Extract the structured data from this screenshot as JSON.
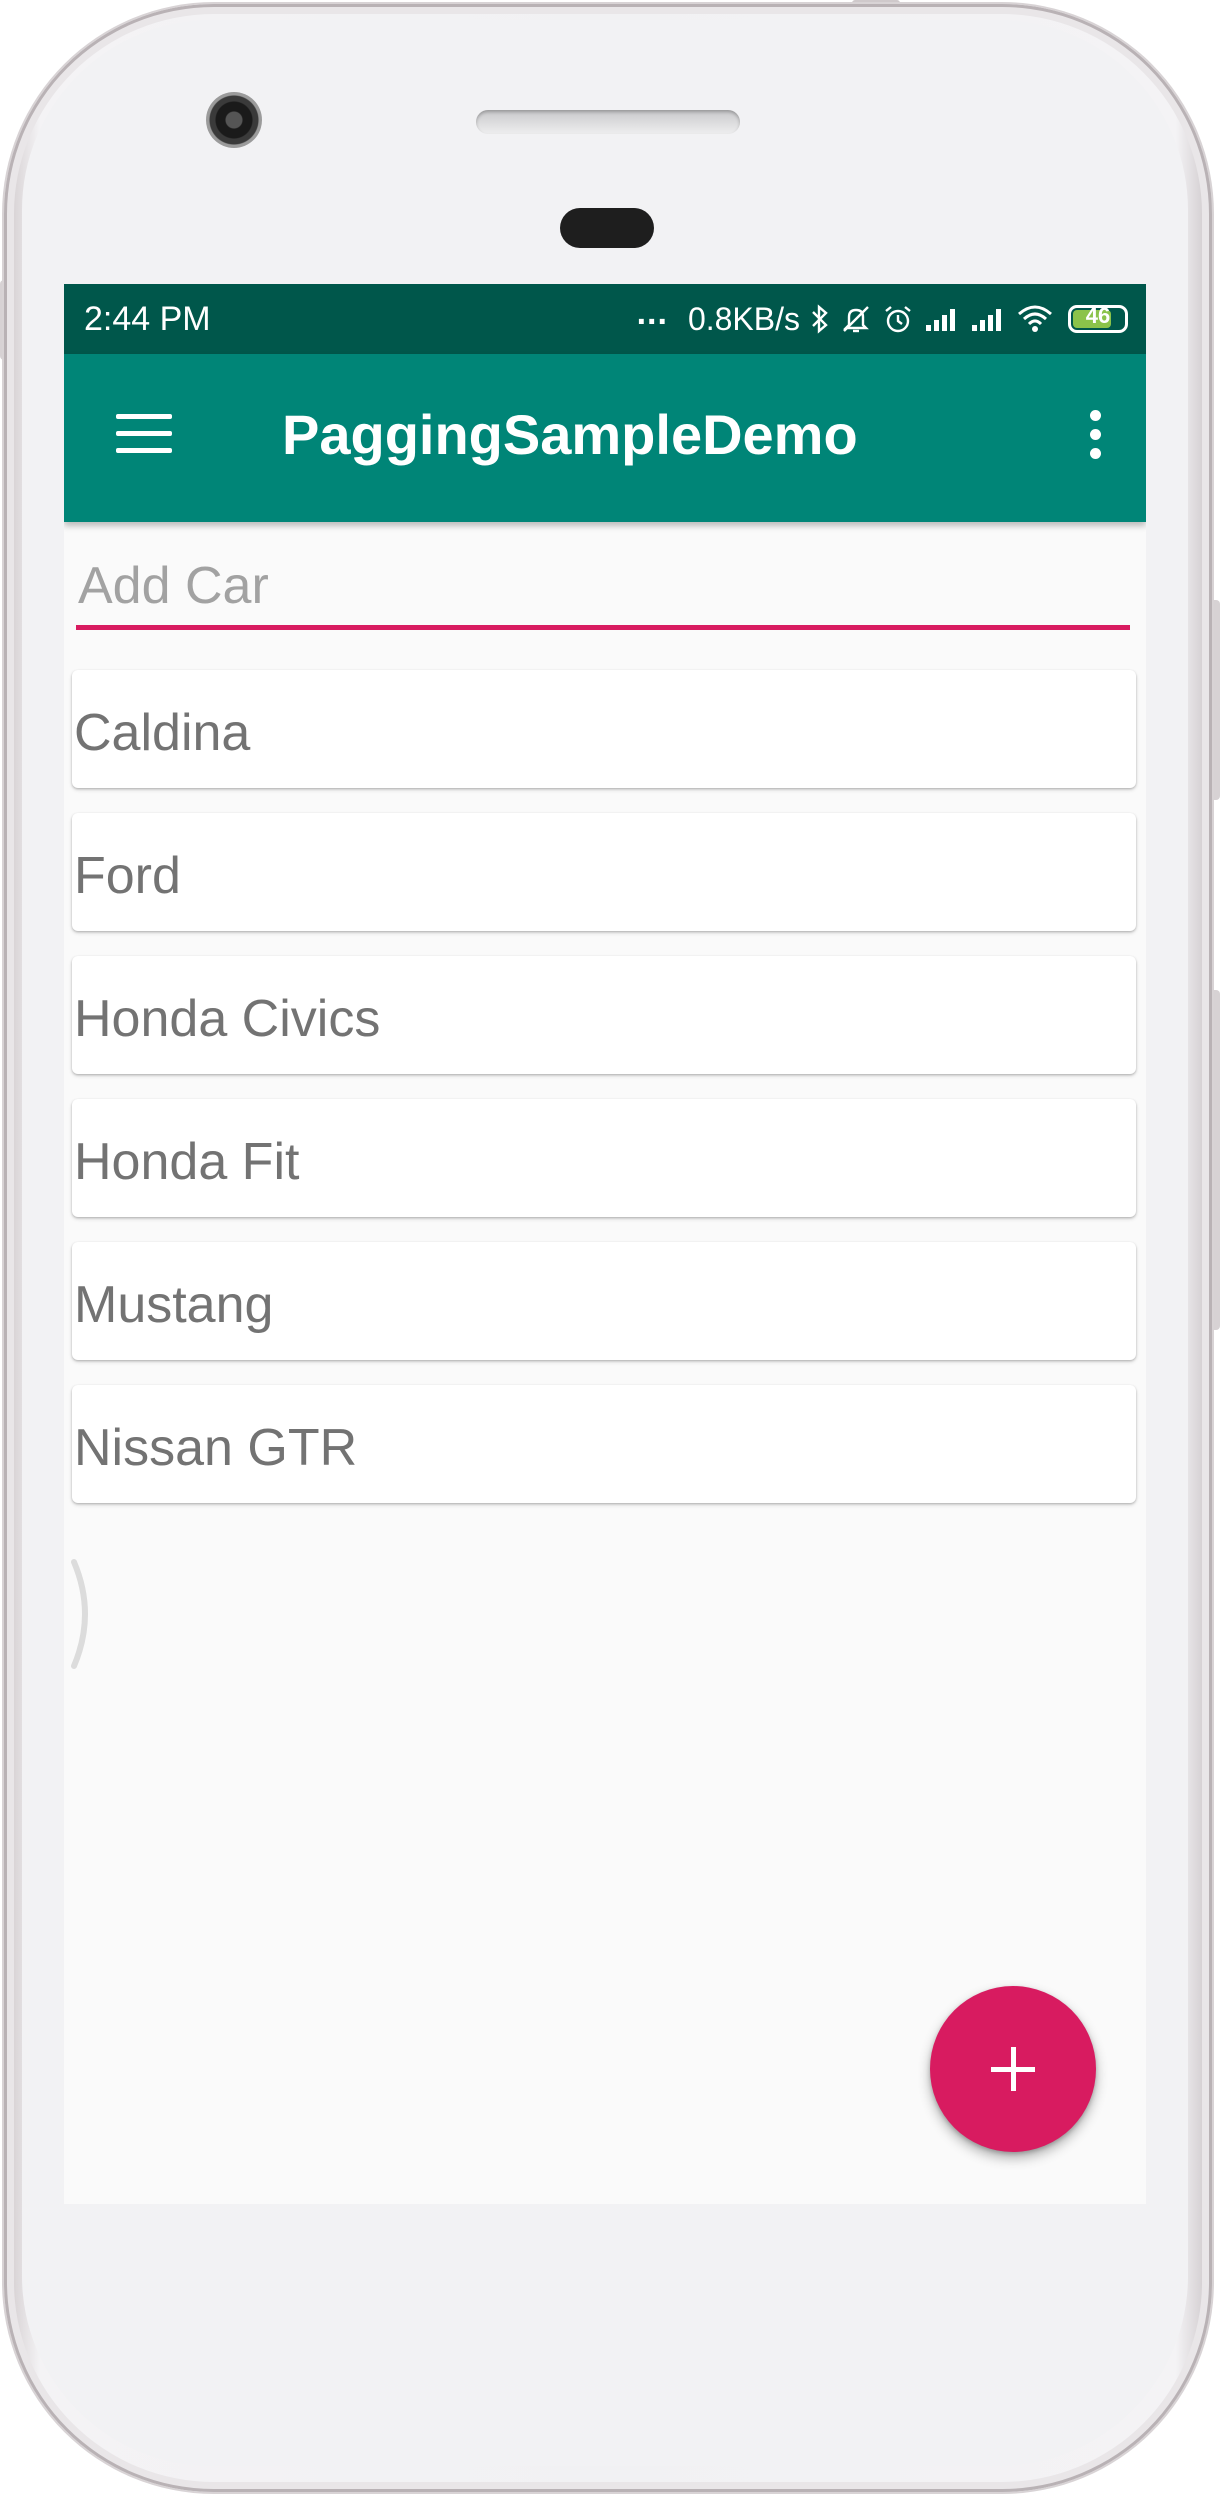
{
  "status_bar": {
    "time": "2:44  PM",
    "more_indicator": "...",
    "network_speed": "0.8KB/s",
    "battery_level": "46",
    "icons": [
      "bluetooth-icon",
      "mute-icon",
      "alarm-icon",
      "signal-icon",
      "signal-icon",
      "wifi-icon",
      "battery-icon"
    ]
  },
  "app_bar": {
    "title": "PaggingSampleDemo",
    "menu_icon": "hamburger-menu-icon",
    "overflow_icon": "more-vert-icon"
  },
  "add_car": {
    "placeholder": "Add Car",
    "value": ""
  },
  "cars": [
    {
      "name": "Caldina"
    },
    {
      "name": "Ford"
    },
    {
      "name": "Honda Civics"
    },
    {
      "name": "Honda Fit"
    },
    {
      "name": "Mustang"
    },
    {
      "name": "Nissan GTR"
    }
  ],
  "fab": {
    "icon": "add-icon"
  },
  "colors": {
    "status_bar": "#00574b",
    "app_bar": "#008577",
    "accent": "#d81b60",
    "list_text": "#737373",
    "background": "#fafafa"
  }
}
